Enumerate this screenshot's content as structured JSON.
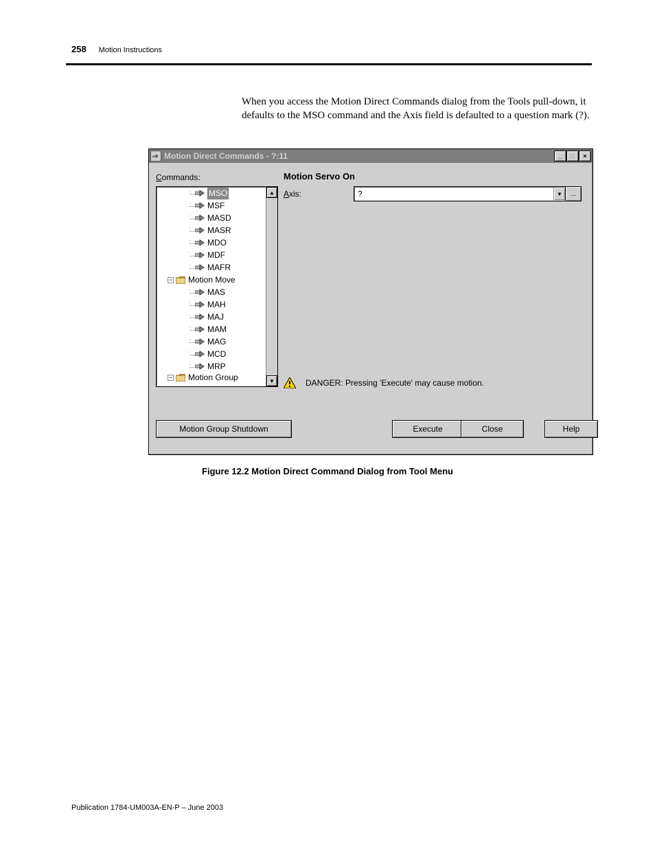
{
  "page": {
    "number": "258",
    "chapter": "Motion Instructions"
  },
  "intro": "When you access the Motion Direct Commands dialog from the Tools pull-down, it defaults to the MSO command and the Axis field is defaulted to a question mark (?).",
  "dialog": {
    "title": "Motion Direct Commands  - ?:11",
    "commands_label_pre": "C",
    "commands_label_u": "",
    "commands_label_full": "ommands:",
    "right_title": "Motion Servo On",
    "axis_label_u": "A",
    "axis_label_rest": "xis:",
    "axis_value": "?",
    "warning": "DANGER: Pressing 'Execute' may cause motion.",
    "buttons": {
      "shutdown": "Motion Group Shutdown",
      "execute": "Execute",
      "close": "Close",
      "help": "Help"
    },
    "tree": {
      "selected": "MSO",
      "items_leaf_a": [
        "MSO",
        "MSF",
        "MASD",
        "MASR",
        "MDO",
        "MDF",
        "MAFR"
      ],
      "folder_move": "Motion Move",
      "items_leaf_b": [
        "MAS",
        "MAH",
        "MAJ",
        "MAM",
        "MAG",
        "MCD",
        "MRP"
      ],
      "folder_group": "Motion Group"
    },
    "commands_underline": "C"
  },
  "caption": "Figure 12.2 Motion Direct Command Dialog from Tool Menu",
  "footer": "Publication 1784-UM003A-EN-P – June 2003"
}
